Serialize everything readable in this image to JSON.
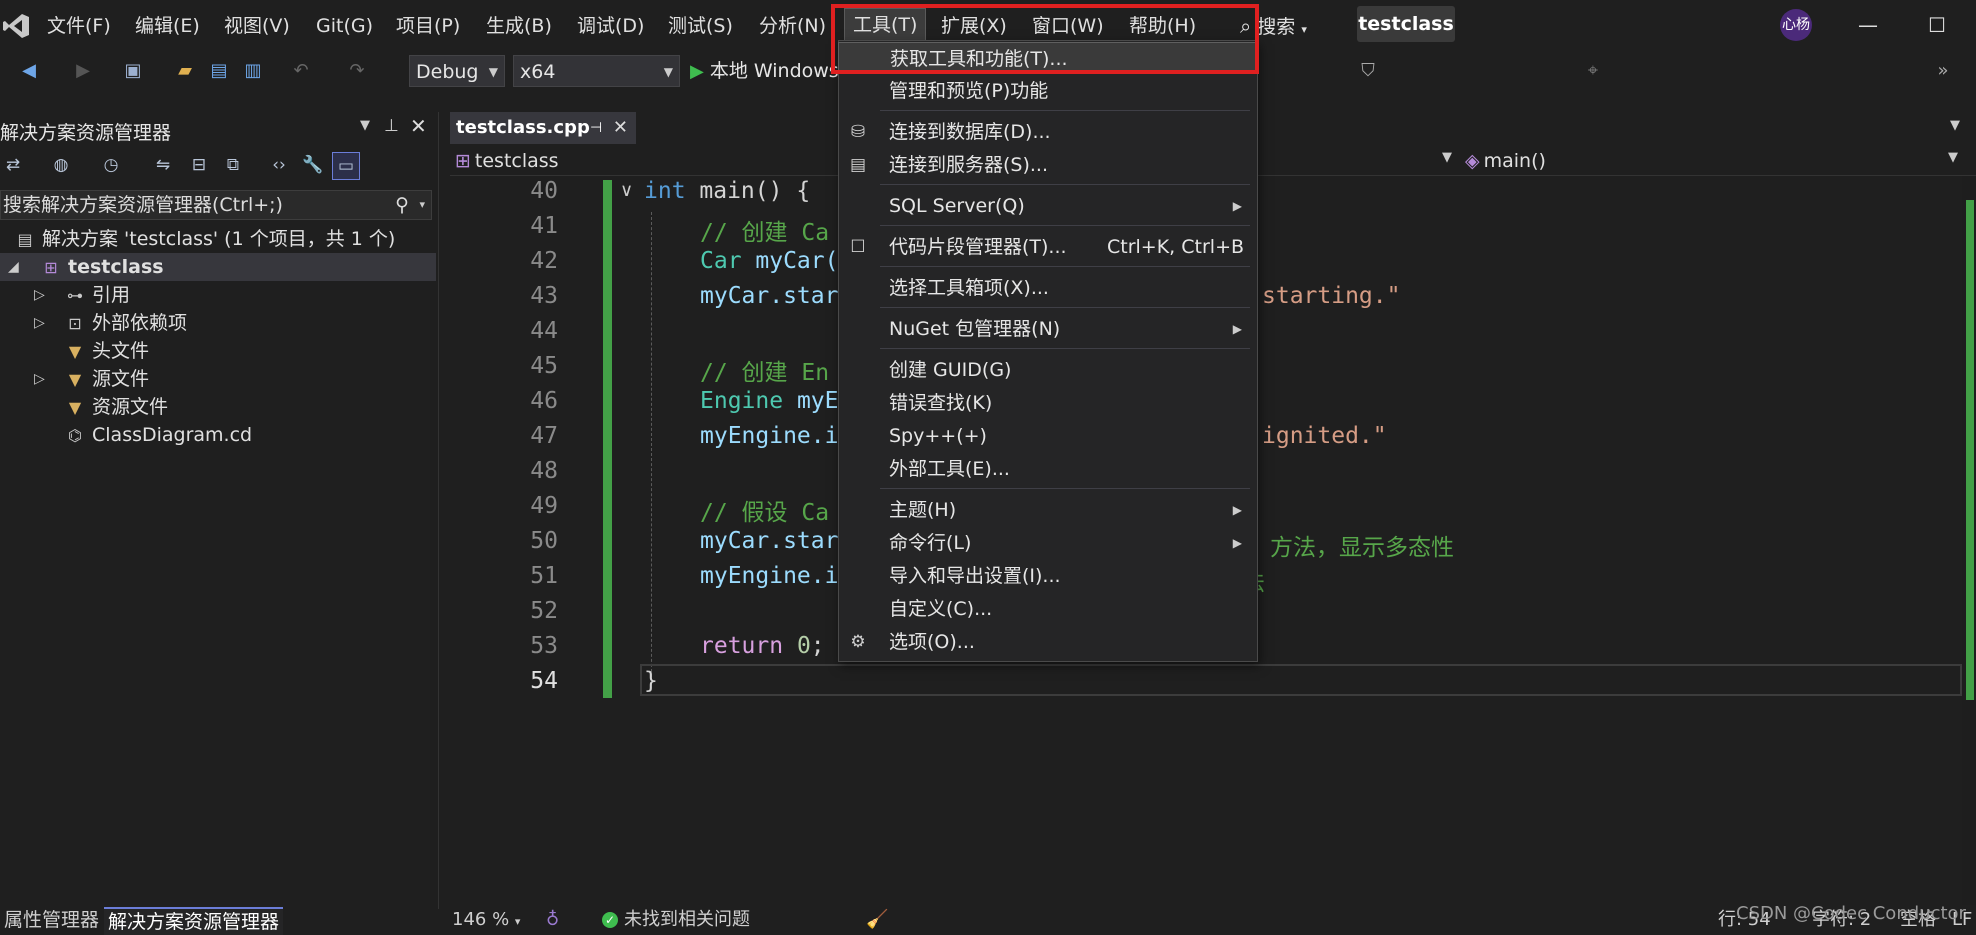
{
  "menubar": {
    "items": [
      "文件(F)",
      "编辑(E)",
      "视图(V)",
      "Git(G)",
      "项目(P)",
      "生成(B)",
      "调试(D)",
      "测试(S)",
      "分析(N)",
      "工具(T)",
      "扩展(X)",
      "窗口(W)",
      "帮助(H)"
    ],
    "search_label": "搜索",
    "project_title": "testclass",
    "avatar_text": "心杨"
  },
  "toolbar": {
    "config": "Debug",
    "platform": "x64",
    "run_label": "本地 Windows"
  },
  "solution_explorer": {
    "title": "解决方案资源管理器",
    "search_placeholder": "搜索解决方案资源管理器(Ctrl+;)",
    "solution_label": "解决方案 'testclass' (1 个项目，共 1 个)",
    "project": "testclass",
    "items": [
      "引用",
      "外部依赖项",
      "头文件",
      "源文件",
      "资源文件",
      "ClassDiagram.cd"
    ]
  },
  "bottom_tabs": [
    "属性管理器",
    "解决方案资源管理器"
  ],
  "editor": {
    "tab_name": "testclass.cpp",
    "nav_left": "testclass",
    "nav_right": "main()",
    "line_numbers": [
      "40",
      "41",
      "42",
      "43",
      "44",
      "45",
      "46",
      "47",
      "48",
      "49",
      "50",
      "51",
      "52",
      "53",
      "54"
    ],
    "code": {
      "l40_kw": "int",
      "l40_rest": " main() {",
      "l41": "// 创建 Ca",
      "l42_type": "Car",
      "l42_var": " myCar(",
      "l43_var": "myCar.star",
      "l43_str": "starting.\"",
      "l45": "// 创建 En",
      "l46_type": "Engine",
      "l46_var": " myE",
      "l47_var": "myEngine.i",
      "l47_str": "ignited.\"",
      "l49": "// 假设 Ca",
      "l50_var": "myCar.star",
      "l50_cm": "方法，显示多态性",
      "l51_var": "myEngine.i",
      "l51_cm": "法",
      "l53_kw": "return",
      "l53_num": " 0",
      "l53_end": ";",
      "l54": "}"
    }
  },
  "tools_menu": {
    "items": [
      {
        "label": "获取工具和功能(T)...",
        "shortcut": "",
        "submenu": false,
        "icon": ""
      },
      {
        "label": "管理和预览(P)功能",
        "shortcut": "",
        "submenu": false,
        "icon": ""
      },
      {
        "label": "连接到数据库(D)...",
        "shortcut": "",
        "submenu": false,
        "icon": "database-icon"
      },
      {
        "label": "连接到服务器(S)...",
        "shortcut": "",
        "submenu": false,
        "icon": "server-icon"
      },
      {
        "label": "SQL Server(Q)",
        "shortcut": "",
        "submenu": true,
        "icon": ""
      },
      {
        "label": "代码片段管理器(T)...",
        "shortcut": "Ctrl+K, Ctrl+B",
        "submenu": false,
        "icon": "snippet-icon"
      },
      {
        "label": "选择工具箱项(X)...",
        "shortcut": "",
        "submenu": false,
        "icon": ""
      },
      {
        "label": "NuGet 包管理器(N)",
        "shortcut": "",
        "submenu": true,
        "icon": ""
      },
      {
        "label": "创建 GUID(G)",
        "shortcut": "",
        "submenu": false,
        "icon": ""
      },
      {
        "label": "错误查找(K)",
        "shortcut": "",
        "submenu": false,
        "icon": ""
      },
      {
        "label": "Spy++(+)",
        "shortcut": "",
        "submenu": false,
        "icon": ""
      },
      {
        "label": "外部工具(E)...",
        "shortcut": "",
        "submenu": false,
        "icon": ""
      },
      {
        "label": "主题(H)",
        "shortcut": "",
        "submenu": true,
        "icon": ""
      },
      {
        "label": "命令行(L)",
        "shortcut": "",
        "submenu": true,
        "icon": ""
      },
      {
        "label": "导入和导出设置(I)...",
        "shortcut": "",
        "submenu": false,
        "icon": ""
      },
      {
        "label": "自定义(C)...",
        "shortcut": "",
        "submenu": false,
        "icon": ""
      },
      {
        "label": "选项(O)...",
        "shortcut": "",
        "submenu": false,
        "icon": "gear-icon"
      }
    ]
  },
  "statusbar": {
    "zoom": "146 %",
    "issues": "未找到相关问题",
    "line": "行: 54",
    "char": "字符: 2",
    "space": "空格",
    "eol": "LF"
  },
  "watermark": "CSDN @Codec Conductor",
  "colors": {
    "accent": "#6b7dd8",
    "highlight_box": "#e02020",
    "change_bar": "#43a047"
  }
}
